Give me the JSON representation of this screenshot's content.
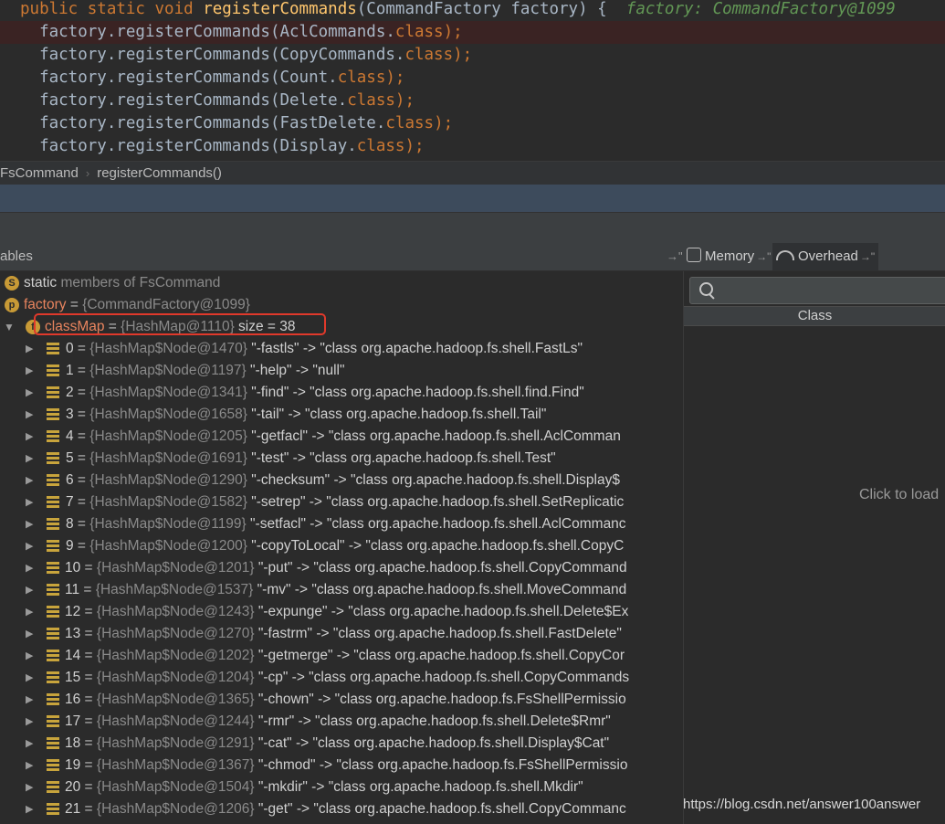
{
  "editor": {
    "lines": [
      {
        "tokens": [
          {
            "t": "public static void ",
            "c": "kw"
          },
          {
            "t": "registerCommands",
            "c": "fn"
          },
          {
            "t": "(CommandFactory factory) {  ",
            "c": ""
          },
          {
            "t": "factory: CommandFactory@1099",
            "c": "hint"
          }
        ],
        "highlight": false
      },
      {
        "tokens": [
          {
            "t": "  factory.",
            "c": ""
          },
          {
            "t": "registerCommands",
            "c": ""
          },
          {
            "t": "(AclCommands.",
            "c": ""
          },
          {
            "t": "class",
            "c": "kw"
          },
          {
            "t": ");",
            "c": "kw"
          }
        ],
        "highlight": true
      },
      {
        "tokens": [
          {
            "t": "  factory.",
            "c": ""
          },
          {
            "t": "registerCommands",
            "c": ""
          },
          {
            "t": "(CopyCommands.",
            "c": ""
          },
          {
            "t": "class",
            "c": "kw"
          },
          {
            "t": ");",
            "c": "kw"
          }
        ],
        "highlight": false
      },
      {
        "tokens": [
          {
            "t": "  factory.",
            "c": ""
          },
          {
            "t": "registerCommands",
            "c": ""
          },
          {
            "t": "(Count.",
            "c": ""
          },
          {
            "t": "class",
            "c": "kw"
          },
          {
            "t": ");",
            "c": "kw"
          }
        ],
        "highlight": false
      },
      {
        "tokens": [
          {
            "t": "  factory.",
            "c": ""
          },
          {
            "t": "registerCommands",
            "c": ""
          },
          {
            "t": "(Delete.",
            "c": ""
          },
          {
            "t": "class",
            "c": "kw"
          },
          {
            "t": ");",
            "c": "kw"
          }
        ],
        "highlight": false
      },
      {
        "tokens": [
          {
            "t": "  factory.",
            "c": ""
          },
          {
            "t": "registerCommands",
            "c": ""
          },
          {
            "t": "(FastDelete.",
            "c": ""
          },
          {
            "t": "class",
            "c": "kw"
          },
          {
            "t": ");",
            "c": "kw"
          }
        ],
        "highlight": false
      },
      {
        "tokens": [
          {
            "t": "  factory.",
            "c": ""
          },
          {
            "t": "registerCommands",
            "c": ""
          },
          {
            "t": "(Display.",
            "c": ""
          },
          {
            "t": "class",
            "c": "kw"
          },
          {
            "t": ");",
            "c": "kw"
          }
        ],
        "highlight": false
      }
    ]
  },
  "breadcrumb": {
    "items": [
      "FsCommand",
      "registerCommands()"
    ],
    "separator": "›"
  },
  "variables": {
    "title": "ables",
    "pin_arrow": "→\""
  },
  "tabs": {
    "memory": {
      "label": "Memory",
      "pin": "→\""
    },
    "overhead": {
      "label": "Overhead",
      "pin": "→\""
    }
  },
  "tree": {
    "static_row": {
      "badge": "S",
      "keyword": "static",
      "rest": " members of FsCommand"
    },
    "factory_row": {
      "badge": "p",
      "name": "factory",
      "eq": " = ",
      "value": "{CommandFactory@1099}"
    },
    "classmap_row": {
      "badge": "f",
      "arrow": "▼",
      "name": "classMap",
      "eq": " = ",
      "value": "{HashMap@1110}",
      "size": "  size = 38"
    },
    "entries": [
      {
        "index": "0",
        "node": "{HashMap$Node@1470}",
        "entry": " \"-fastls\" -> \"class org.apache.hadoop.fs.shell.FastLs\""
      },
      {
        "index": "1",
        "node": "{HashMap$Node@1197}",
        "entry": " \"-help\" -> \"null\""
      },
      {
        "index": "2",
        "node": "{HashMap$Node@1341}",
        "entry": " \"-find\" -> \"class org.apache.hadoop.fs.shell.find.Find\""
      },
      {
        "index": "3",
        "node": "{HashMap$Node@1658}",
        "entry": " \"-tail\" -> \"class org.apache.hadoop.fs.shell.Tail\""
      },
      {
        "index": "4",
        "node": "{HashMap$Node@1205}",
        "entry": " \"-getfacl\" -> \"class org.apache.hadoop.fs.shell.AclComman"
      },
      {
        "index": "5",
        "node": "{HashMap$Node@1691}",
        "entry": " \"-test\" -> \"class org.apache.hadoop.fs.shell.Test\""
      },
      {
        "index": "6",
        "node": "{HashMap$Node@1290}",
        "entry": " \"-checksum\" -> \"class org.apache.hadoop.fs.shell.Display$"
      },
      {
        "index": "7",
        "node": "{HashMap$Node@1582}",
        "entry": " \"-setrep\" -> \"class org.apache.hadoop.fs.shell.SetReplicatic"
      },
      {
        "index": "8",
        "node": "{HashMap$Node@1199}",
        "entry": " \"-setfacl\" -> \"class org.apache.hadoop.fs.shell.AclCommanc"
      },
      {
        "index": "9",
        "node": "{HashMap$Node@1200}",
        "entry": " \"-copyToLocal\" -> \"class org.apache.hadoop.fs.shell.CopyC"
      },
      {
        "index": "10",
        "node": "{HashMap$Node@1201}",
        "entry": " \"-put\" -> \"class org.apache.hadoop.fs.shell.CopyCommand"
      },
      {
        "index": "11",
        "node": "{HashMap$Node@1537}",
        "entry": " \"-mv\" -> \"class org.apache.hadoop.fs.shell.MoveCommand"
      },
      {
        "index": "12",
        "node": "{HashMap$Node@1243}",
        "entry": " \"-expunge\" -> \"class org.apache.hadoop.fs.shell.Delete$Ex"
      },
      {
        "index": "13",
        "node": "{HashMap$Node@1270}",
        "entry": " \"-fastrm\" -> \"class org.apache.hadoop.fs.shell.FastDelete\""
      },
      {
        "index": "14",
        "node": "{HashMap$Node@1202}",
        "entry": " \"-getmerge\" -> \"class org.apache.hadoop.fs.shell.CopyCor"
      },
      {
        "index": "15",
        "node": "{HashMap$Node@1204}",
        "entry": " \"-cp\" -> \"class org.apache.hadoop.fs.shell.CopyCommands"
      },
      {
        "index": "16",
        "node": "{HashMap$Node@1365}",
        "entry": " \"-chown\" -> \"class org.apache.hadoop.fs.FsShellPermissio"
      },
      {
        "index": "17",
        "node": "{HashMap$Node@1244}",
        "entry": " \"-rmr\" -> \"class org.apache.hadoop.fs.shell.Delete$Rmr\""
      },
      {
        "index": "18",
        "node": "{HashMap$Node@1291}",
        "entry": " \"-cat\" -> \"class org.apache.hadoop.fs.shell.Display$Cat\""
      },
      {
        "index": "19",
        "node": "{HashMap$Node@1367}",
        "entry": " \"-chmod\" -> \"class org.apache.hadoop.fs.FsShellPermissio"
      },
      {
        "index": "20",
        "node": "{HashMap$Node@1504}",
        "entry": " \"-mkdir\" -> \"class org.apache.hadoop.fs.shell.Mkdir\""
      },
      {
        "index": "21",
        "node": "{HashMap$Node@1206}",
        "entry": " \"-get\" -> \"class org.apache.hadoop.fs.shell.CopyCommanc"
      }
    ],
    "expand_arrow": "▶",
    "collapse_arrow": "▼"
  },
  "memory": {
    "column": "Class",
    "load_text": "Click to load"
  },
  "watermark": "https://blog.csdn.net/answer100answer",
  "colors": {
    "editor_bg": "#2b2b2b",
    "keyword": "#cc7832",
    "function": "#ffc66d",
    "hint": "#629755",
    "var_name": "#e8845e",
    "badge": "#c89a36",
    "highlight_box": "#e0392b",
    "selected_strip": "#3d4b5c"
  }
}
